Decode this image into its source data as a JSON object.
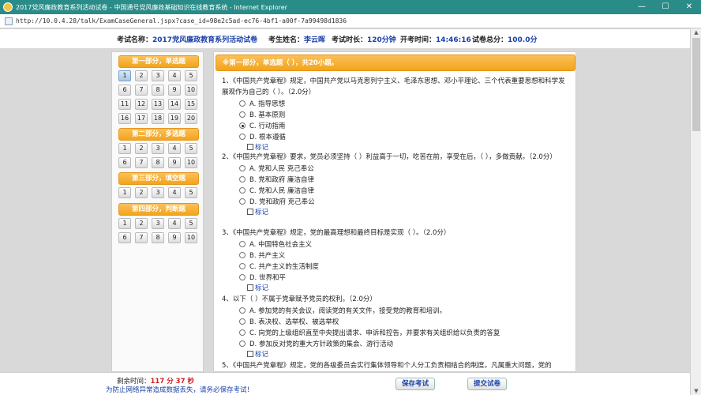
{
  "window": {
    "title": "2017党风廉政教育系列活动试卷 - 中国通号党风廉政基础知识在线教育系统 - Internet Explorer",
    "minimize": "—",
    "maximize": "☐",
    "close": "✕",
    "url": "http://10.0.4.28/talk/ExamCaseGeneral.jspx?case_id=98e2c5ad-ec76-4bf1-a00f-7a99498d1836"
  },
  "header": {
    "exam_name_label": "考试名称：",
    "exam_name": "2017党风廉政教育系列活动试卷",
    "examinee_label": "考生姓名：",
    "examinee": "李云晖",
    "duration_label": "考试时长：",
    "duration": "120分钟",
    "start_label": "开考时间：",
    "start": "14:46:16",
    "total_label": "试卷总分：",
    "total": "100.0分"
  },
  "sidebar": {
    "sections": [
      {
        "title": "第一部分，单选题",
        "numbers": [
          "1",
          "2",
          "3",
          "4",
          "5",
          "6",
          "7",
          "8",
          "9",
          "10",
          "11",
          "12",
          "13",
          "14",
          "15",
          "16",
          "17",
          "18",
          "19",
          "20"
        ]
      },
      {
        "title": "第二部分，多选题",
        "numbers": [
          "1",
          "2",
          "3",
          "4",
          "5",
          "6",
          "7",
          "8",
          "9",
          "10"
        ]
      },
      {
        "title": "第三部分，填空题",
        "numbers": [
          "1",
          "2",
          "3",
          "4",
          "5"
        ]
      },
      {
        "title": "第四部分，判断题",
        "numbers": [
          "1",
          "2",
          "3",
          "4",
          "5",
          "6",
          "7",
          "8",
          "9",
          "10"
        ]
      }
    ]
  },
  "main": {
    "section_title": "※第一部分，单选题（ ），共20小题。",
    "mark_label": "标记",
    "questions": [
      {
        "text": "1、《中国共产党章程》规定，中国共产党以马克思列宁主义、毛泽东思想、邓小平理论、三个代表重要思想和科学发展观作为自己的（ ）。（2.0分）",
        "options": [
          "A. 指导思想",
          "B. 基本原则",
          "C. 行动指南",
          "D. 根本遵循"
        ],
        "selected": 2
      },
      {
        "text": "2、《中国共产党章程》要求，党员必须坚持（ ）利益高于一切，吃苦在前，享受在后，（ ），多做贡献。（2.0分）",
        "options": [
          "A. 党和人民 克己奉公",
          "B. 党和政府 廉洁自律",
          "C. 党和人民 廉洁自律",
          "D. 党和政府 克己奉公"
        ],
        "selected": -1
      },
      {
        "text": "3、《中国共产党章程》规定，党的最高理想和最终目标是实现（ ）。（2.0分）",
        "options": [
          "A. 中国特色社会主义",
          "B. 共产主义",
          "C. 共产主义的生活制度",
          "D. 世界和平"
        ],
        "selected": -1
      },
      {
        "text": "4、以下（ ）不属于党章赋予党员的权利。（2.0分）",
        "options": [
          "A. 参加党的有关会议，阅读党的有关文件，接受党的教育和培训。",
          "B. 表决权、选举权、被选举权",
          "C. 向党的上级组织直至中央提出请求、申诉和控告，并要求有关组织给以负责的答复",
          "D. 参加反对党的重大方针政策的集会、游行活动"
        ],
        "selected": -1
      },
      {
        "text": "5、《中国共产党章程》规定，党的各级委员会实行集体领导和个人分工负责相结合的制度。凡属重大问题，党的",
        "options": [],
        "selected": -1
      }
    ]
  },
  "footer": {
    "remaining_label": "剩余时间：",
    "remaining": "117 分 37 秒",
    "warning": "为防止网络异常造成数据丢失，请务必保存考试！",
    "save_button": "保存考试",
    "submit_button": "提交试卷"
  }
}
